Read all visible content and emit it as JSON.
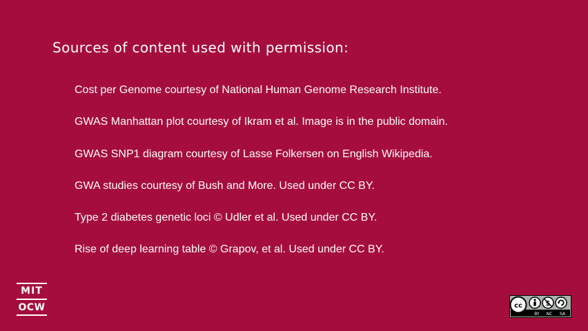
{
  "title": "Sources of content used with permission:",
  "sources": [
    "Cost per Genome courtesy of National Human Genome Research Institute.",
    "GWAS Manhattan plot courtesy of Ikram et al. Image is in the public domain.",
    "GWAS SNP1 diagram courtesy of Lasse Folkersen on English Wikipedia.",
    "GWA studies courtesy of Bush and More. Used under CC BY.",
    "Type 2 diabetes genetic loci © Udler et al. Used under CC BY.",
    "Rise of deep learning table © Grapov, et al. Used under CC BY."
  ],
  "logo": {
    "line1": "MIT",
    "line2": "OCW"
  },
  "license_badge": {
    "by": "BY",
    "nc": "NC",
    "sa": "SA"
  },
  "colors": {
    "background": "#a50d3c",
    "text": "#ffffff"
  }
}
